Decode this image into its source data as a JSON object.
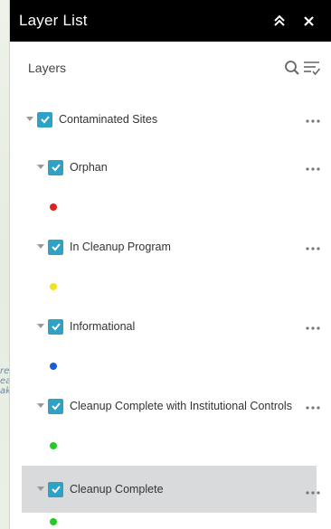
{
  "window": {
    "title": "Layer List"
  },
  "header": {
    "label": "Layers"
  },
  "colors": {
    "checkbox": "#2ea1c7",
    "titlebar": "#000000",
    "selected_row": "#d9dadb"
  },
  "map": {
    "edge_text": "re\nea\nak"
  },
  "layers": [
    {
      "label": "Contaminated Sites",
      "checked": true,
      "level": 0
    },
    {
      "label": "Orphan",
      "checked": true,
      "level": 1,
      "symbol_color": "#e02020"
    },
    {
      "label": "In Cleanup Program",
      "checked": true,
      "level": 1,
      "symbol_color": "#f2e21a"
    },
    {
      "label": "Informational",
      "checked": true,
      "level": 1,
      "symbol_color": "#1a5bd6"
    },
    {
      "label": "Cleanup Complete with Institutional Controls",
      "checked": true,
      "level": 1,
      "symbol_color": "#22cc22"
    },
    {
      "label": "Cleanup Complete",
      "checked": true,
      "level": 1,
      "selected": true,
      "symbol_color": "#22cc22"
    }
  ],
  "icons": {
    "collapse": "double-chevron-up-icon",
    "close": "close-icon",
    "search": "search-icon",
    "filter": "filter-list-icon",
    "more": "more-options-icon",
    "caret": "caret-down-icon",
    "check": "checkmark-icon"
  }
}
